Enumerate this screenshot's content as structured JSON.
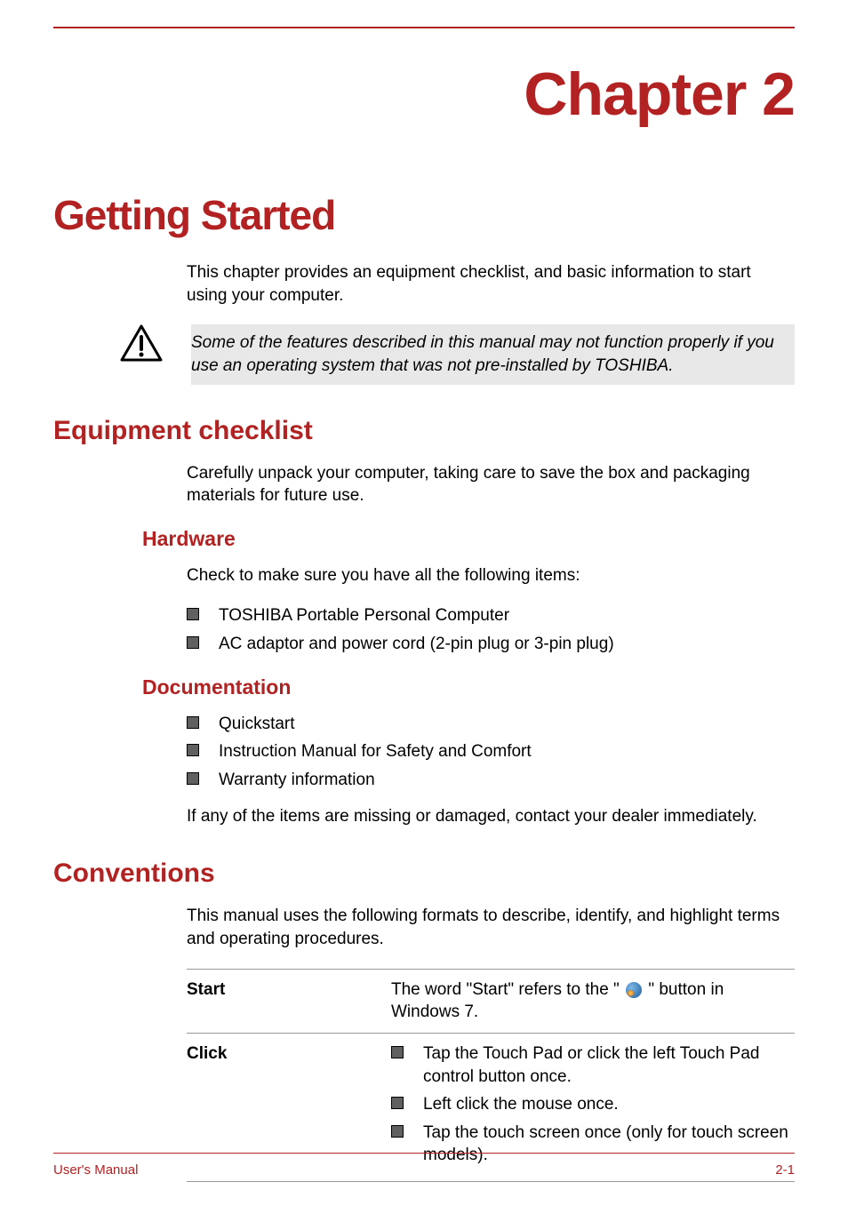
{
  "chapter_title": "Chapter 2",
  "main_title": "Getting Started",
  "intro_text": "This chapter provides an equipment checklist, and basic information to start using your computer.",
  "warning_text": "Some of the features described in this manual may not function properly if you use an operating system that was not pre-installed by TOSHIBA.",
  "sections": {
    "equipment": {
      "title": "Equipment checklist",
      "intro": "Carefully unpack your computer, taking care to save the box and packaging materials for future use.",
      "hardware": {
        "title": "Hardware",
        "intro": "Check to make sure you have all the following items:",
        "items": [
          "TOSHIBA Portable Personal Computer",
          "AC adaptor and power cord (2-pin plug or 3-pin plug)"
        ]
      },
      "documentation": {
        "title": "Documentation",
        "items": [
          "Quickstart",
          "Instruction Manual for Safety and Comfort",
          "Warranty information"
        ],
        "after": "If any of the items are missing or damaged, contact your dealer immediately."
      }
    },
    "conventions": {
      "title": "Conventions",
      "intro": "This manual uses the following formats to describe, identify, and highlight terms and operating procedures.",
      "rows": [
        {
          "term": "Start",
          "desc_prefix": "The word \"Start\" refers to the \" ",
          "desc_suffix": " \" button in Windows 7."
        },
        {
          "term": "Click",
          "bullets": [
            "Tap the Touch Pad or click the left Touch Pad control button once.",
            "Left click the mouse once.",
            "Tap the touch screen once (only for touch screen models)."
          ]
        }
      ]
    }
  },
  "footer": {
    "left": "User's Manual",
    "right": "2-1"
  }
}
